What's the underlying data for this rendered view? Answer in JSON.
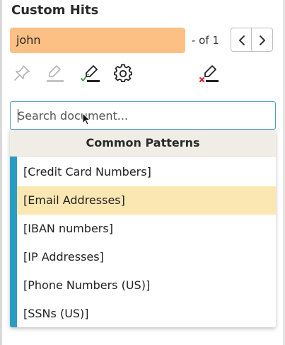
{
  "panel": {
    "title": "Custom Hits"
  },
  "hit_search": {
    "value": "john",
    "count_text": "- of 1"
  },
  "nav": {
    "prev_icon": "chevron-left-icon",
    "next_icon": "chevron-right-icon"
  },
  "toolbar": {
    "icons": [
      "pin-icon",
      "highlighter-icon",
      "highlighter-check-icon",
      "gear-icon",
      "highlighter-remove-icon"
    ]
  },
  "search": {
    "value": "",
    "placeholder": "Search document..."
  },
  "dropdown": {
    "header": "Common Patterns",
    "items": [
      {
        "label": "[Credit Card Numbers]",
        "highlighted": false
      },
      {
        "label": "[Email Addresses]",
        "highlighted": true
      },
      {
        "label": "[IBAN numbers]",
        "highlighted": false
      },
      {
        "label": "[IP Addresses]",
        "highlighted": false
      },
      {
        "label": "[Phone Numbers (US)]",
        "highlighted": false
      },
      {
        "label": "[SSNs (US)]",
        "highlighted": false
      }
    ]
  },
  "colors": {
    "hit_input_bg": "#fdc084",
    "accent": "#2a9cc3",
    "highlight": "#fbe7b2",
    "remove_red": "#d8232a",
    "check_green": "#3a9a3a"
  }
}
